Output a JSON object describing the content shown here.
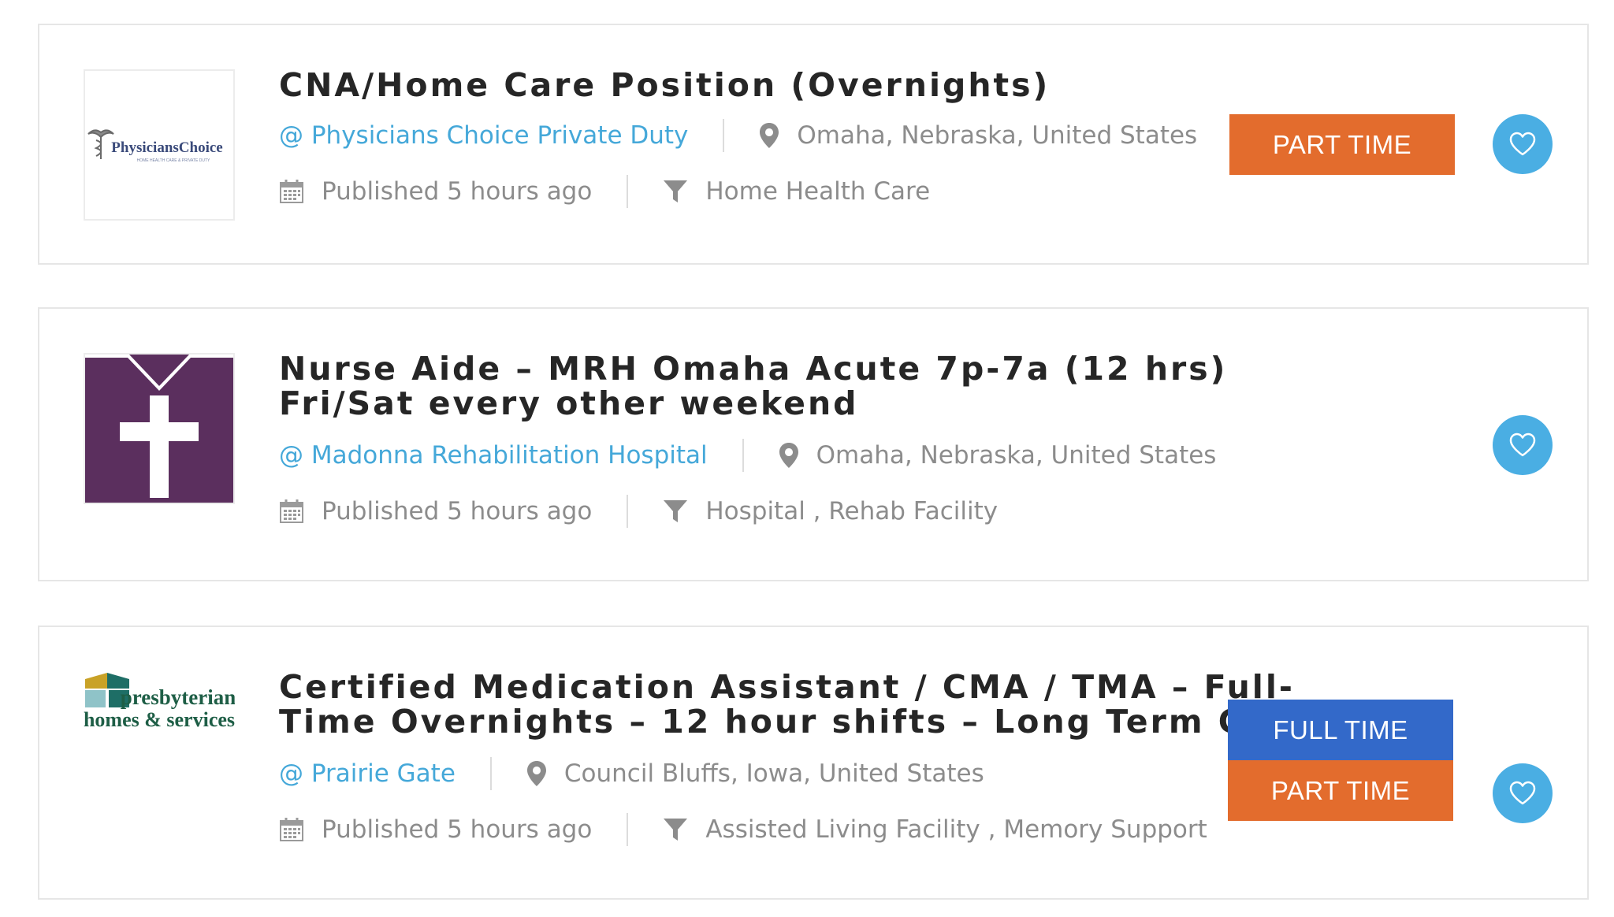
{
  "colors": {
    "link": "#45a8d9",
    "part_time": "#e36c2d",
    "full_time": "#3369c9",
    "favorite": "#4aaee3",
    "meta_text": "#8c8c8c"
  },
  "jobs": [
    {
      "title": "CNA/Home Care Position (Overnights)",
      "company": "@ Physicians Choice Private Duty",
      "location": "Omaha, Nebraska, United States",
      "published": "Published 5 hours ago",
      "category": "Home Health Care",
      "job_types": [
        "PART TIME"
      ],
      "logo": {
        "name": "PhysiciansChoice",
        "tagline": "HOME HEALTH CARE & PRIVATE DUTY",
        "icon": "caduceus-icon"
      }
    },
    {
      "title_line1": "Nurse Aide – MRH Omaha Acute 7p-7a (12 hrs)",
      "title_line2": "Fri/Sat every other weekend",
      "company": "@ Madonna Rehabilitation Hospital",
      "location": "Omaha, Nebraska, United States",
      "published": "Published 5 hours ago",
      "category": "Hospital , Rehab Facility",
      "job_types": [],
      "logo": {
        "icon": "cross-icon",
        "bg_color": "#5b2f5e"
      }
    },
    {
      "title_line1": "Certified Medication Assistant / CMA / TMA – Full-",
      "title_line2": "Time Overnights – 12 hour shifts – Long Term Care",
      "company": "@ Prairie Gate",
      "location": "Council Bluffs, Iowa, United States",
      "published": "Published 5 hours ago",
      "category": "Assisted Living Facility , Memory Support",
      "job_types": [
        "FULL TIME",
        "PART TIME"
      ],
      "logo": {
        "line1": "presbyterian",
        "line2": "homes & services",
        "icon": "house-icon"
      }
    }
  ]
}
